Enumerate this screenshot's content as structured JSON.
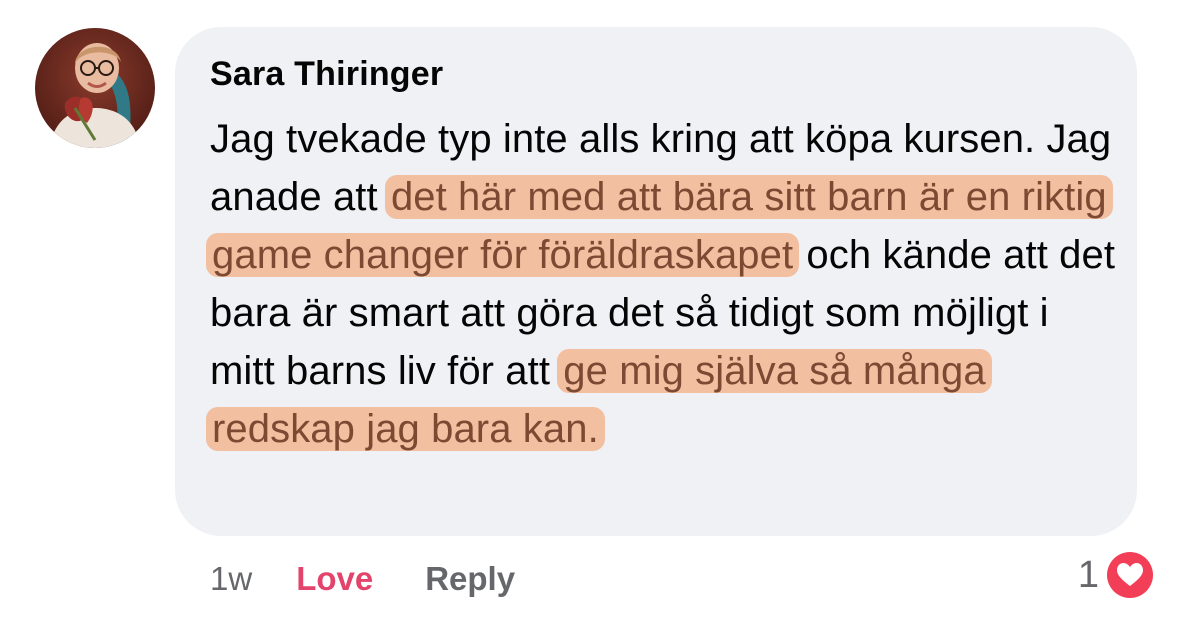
{
  "comment": {
    "author": "Sara Thiringer",
    "text_parts": [
      {
        "text": "Jag tvekade typ inte alls kring att köpa kursen. Jag anade att ",
        "highlight": false
      },
      {
        "text": "det här med att bära sitt barn är en riktig game changer för föräldraskapet",
        "highlight": true
      },
      {
        "text": " och kände att det bara är smart att göra det så tidigt som möjligt i mitt barns liv för att ",
        "highlight": false
      },
      {
        "text": "ge mig själva så många redskap jag bara kan.",
        "highlight": true
      }
    ],
    "highlight_color": "#f5a06e",
    "bubble_color": "#eff1f4"
  },
  "actions": {
    "time": "1w",
    "love_label": "Love",
    "love_color": "#e2446c",
    "reply_label": "Reply"
  },
  "reactions": {
    "count": "1",
    "icon": "heart-icon",
    "icon_color": "#f33e58"
  }
}
